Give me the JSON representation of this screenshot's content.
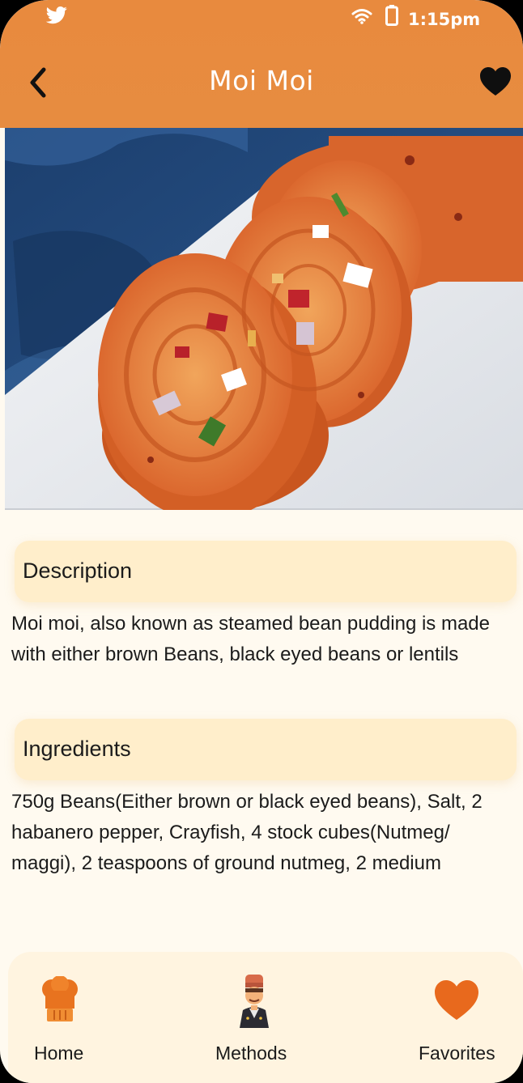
{
  "status_bar": {
    "time": "1:15pm",
    "icons": [
      "twitter-icon",
      "wifi-icon",
      "battery-icon"
    ]
  },
  "header": {
    "title": "Moi Moi",
    "back_icon": "chevron-left-icon",
    "favorite_icon": "heart-icon"
  },
  "hero": {
    "alt": "Moi Moi food photo"
  },
  "description": {
    "heading": "Description",
    "text": "Moi moi, also known as steamed bean pudding is made with either brown Beans, black eyed beans or lentils"
  },
  "ingredients": {
    "heading": "Ingredients",
    "text": "750g Beans(Either brown or black eyed beans), Salt, 2 habanero pepper, Crayfish, 4 stock cubes(Nutmeg/ maggi), 2 teaspoons of ground nutmeg, 2 medium"
  },
  "bottom_nav": {
    "home": {
      "label": "Home",
      "icon": "chef-hat-icon"
    },
    "methods": {
      "label": "Methods",
      "icon": "chef-icon"
    },
    "favorites": {
      "label": "Favorites",
      "icon": "heart-icon"
    }
  },
  "colors": {
    "accent": "#e88a3e",
    "background": "#fffaf0",
    "card": "#ffeecb",
    "nav": "#fff4e0"
  }
}
